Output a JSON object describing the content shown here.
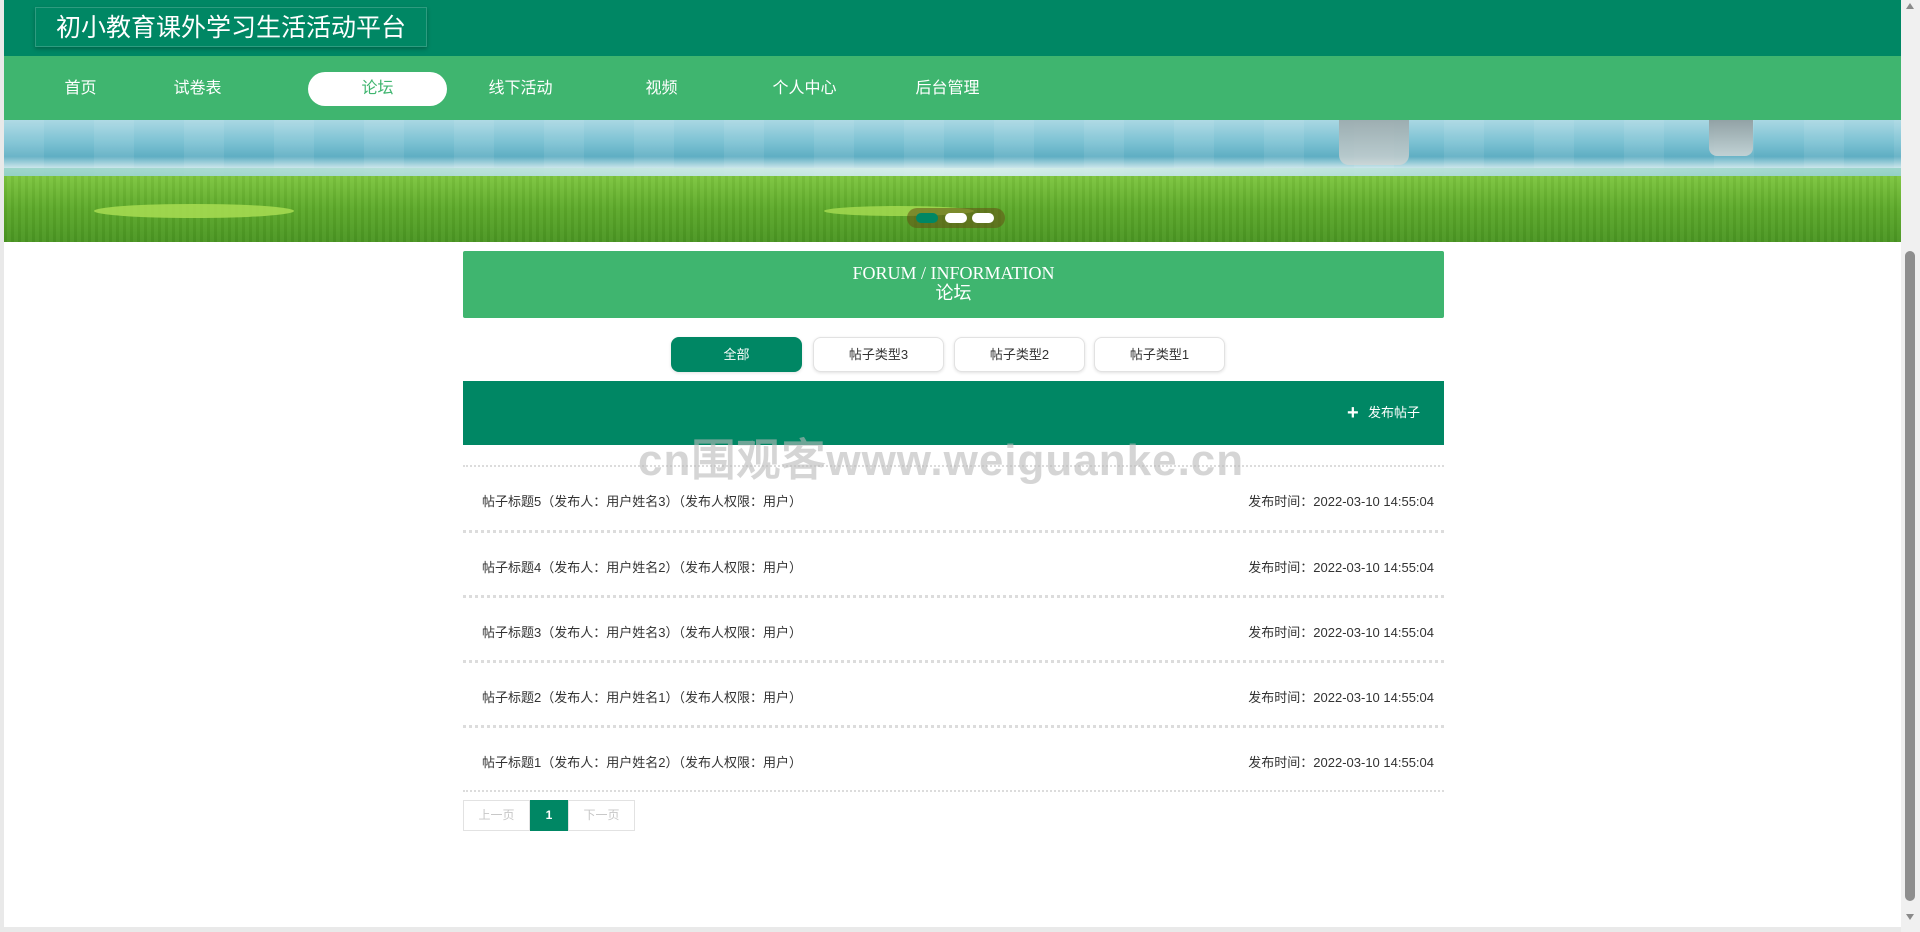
{
  "app": {
    "title": "初小教育课外学习生活活动平台"
  },
  "nav": {
    "items": [
      {
        "label": "首页"
      },
      {
        "label": "试卷表"
      },
      {
        "label": "论坛"
      },
      {
        "label": "线下活动"
      },
      {
        "label": "视频"
      },
      {
        "label": "个人中心"
      },
      {
        "label": "后台管理"
      }
    ],
    "active": "论坛"
  },
  "banner": {
    "slides": 3,
    "active_slide": 1
  },
  "forum": {
    "title_en": "FORUM / INFORMATION",
    "title_cn": "论坛"
  },
  "filters": {
    "tabs": [
      {
        "label": "全部"
      },
      {
        "label": "帖子类型3"
      },
      {
        "label": "帖子类型2"
      },
      {
        "label": "帖子类型1"
      }
    ],
    "active": "全部"
  },
  "actions": {
    "publish_label": "发布帖子"
  },
  "watermark": "cn围观客www.weiguanke.cn",
  "posts": [
    {
      "title": "帖子标题5（发布人：用户姓名3）（发布人权限：用户）",
      "time": "发布时间：2022-03-10 14:55:04"
    },
    {
      "title": "帖子标题4（发布人：用户姓名2）（发布人权限：用户）",
      "time": "发布时间：2022-03-10 14:55:04"
    },
    {
      "title": "帖子标题3（发布人：用户姓名3）（发布人权限：用户）",
      "time": "发布时间：2022-03-10 14:55:04"
    },
    {
      "title": "帖子标题2（发布人：用户姓名1）（发布人权限：用户）",
      "time": "发布时间：2022-03-10 14:55:04"
    },
    {
      "title": "帖子标题1（发布人：用户姓名2）（发布人权限：用户）",
      "time": "发布时间：2022-03-10 14:55:04"
    }
  ],
  "pagination": {
    "prev_label": "上一页",
    "current_page": "1",
    "next_label": "下一页"
  },
  "colors": {
    "primary": "#008764",
    "nav": "#3fb56f",
    "background": "#ffffff"
  }
}
